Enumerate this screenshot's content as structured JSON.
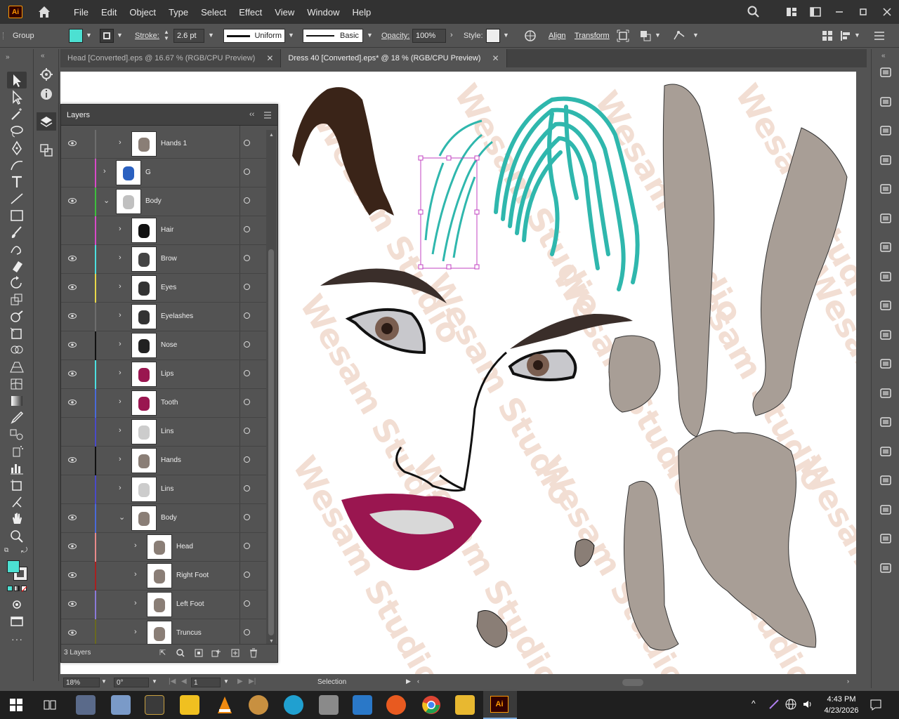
{
  "app": {
    "logo": "Ai"
  },
  "menu": [
    "File",
    "Edit",
    "Object",
    "Type",
    "Select",
    "Effect",
    "View",
    "Window",
    "Help"
  ],
  "control": {
    "selection_type": "Group",
    "fill_color": "#4ce0d2",
    "stroke_label": "Stroke:",
    "stroke_value": "2.6 pt",
    "profile": "Uniform",
    "brush": "Basic",
    "opacity_label": "Opacity:",
    "opacity_value": "100%",
    "style_label": "Style:",
    "align_label": "Align",
    "transform_label": "Transform"
  },
  "tabs": [
    {
      "label": "Head [Converted].eps @ 16.67 % (RGB/CPU Preview)",
      "active": false
    },
    {
      "label": "Dress 40 [Converted].eps* @ 18 % (RGB/CPU Preview)",
      "active": true
    }
  ],
  "layers_panel": {
    "title": "Layers",
    "footer": "3 Layers",
    "rows": [
      {
        "name": "Hands 1",
        "color": "#6d6d6d",
        "visible": true,
        "expanded": false
      },
      {
        "name": "G",
        "color": "#d84ac8",
        "visible": false,
        "expanded": false
      },
      {
        "name": "Body",
        "color": "#3cc23c",
        "visible": true,
        "expanded": true
      },
      {
        "name": "Hair",
        "color": "#d84ac8",
        "visible": false,
        "expanded": false
      },
      {
        "name": "Brow",
        "color": "#4ce0e0",
        "visible": true,
        "expanded": false
      },
      {
        "name": "Eyes",
        "color": "#e8d84a",
        "visible": true,
        "expanded": false
      },
      {
        "name": "Eyelashes",
        "color": "#6d6d6d",
        "visible": true,
        "expanded": false
      },
      {
        "name": "Nose",
        "color": "#111111",
        "visible": true,
        "expanded": false
      },
      {
        "name": "Lips",
        "color": "#4ce0e0",
        "visible": true,
        "expanded": false
      },
      {
        "name": "Tooth",
        "color": "#4a6ad8",
        "visible": true,
        "expanded": false
      },
      {
        "name": "Lins",
        "color": "#4a4ac8",
        "visible": false,
        "expanded": false
      },
      {
        "name": "Hands",
        "color": "#111111",
        "visible": true,
        "expanded": false
      },
      {
        "name": "Lins",
        "color": "#4a4ac8",
        "visible": false,
        "expanded": false
      },
      {
        "name": "Body",
        "color": "#4a6ad8",
        "visible": true,
        "expanded": true
      },
      {
        "name": "Head",
        "color": "#e88a8a",
        "visible": true,
        "expanded": false
      },
      {
        "name": "Right Foot",
        "color": "#a82020",
        "visible": true,
        "expanded": false
      },
      {
        "name": "Left Foot",
        "color": "#8a7ad8",
        "visible": true,
        "expanded": false
      },
      {
        "name": "Truncus",
        "color": "#6a6a20",
        "visible": true,
        "expanded": false
      }
    ]
  },
  "status": {
    "zoom": "18%",
    "rotation": "0°",
    "artboard": "1",
    "mode": "Selection"
  },
  "taskbar": {
    "time": "4:43 PM",
    "date": "4/23/2026"
  },
  "watermark": "Wesam Studio"
}
